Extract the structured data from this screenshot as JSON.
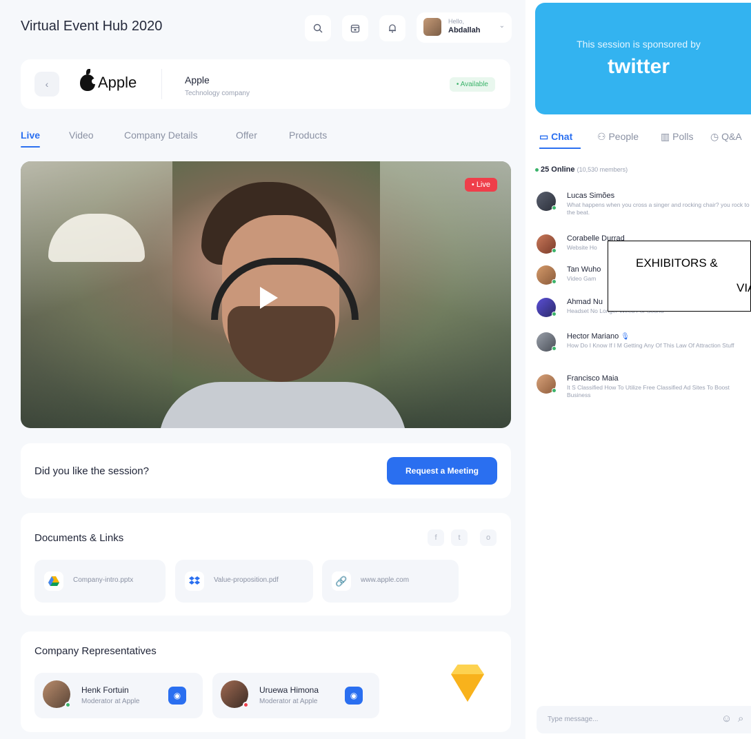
{
  "header": {
    "title": "Virtual Event Hub 2020",
    "greeting": "Hello,",
    "user_name": "Abdallah"
  },
  "company": {
    "logo_text": "Apple",
    "name": "Apple",
    "subtitle": "Technology company",
    "status": "• Available"
  },
  "tabs": [
    "Live",
    "Video",
    "Company Details",
    "Offer",
    "Products"
  ],
  "video": {
    "badge": "• Live"
  },
  "rating": {
    "question": "Did you like the session?",
    "button": "Request a Meeting"
  },
  "documents": {
    "title": "Documents & Links",
    "social": [
      "f",
      "t",
      "o"
    ],
    "items": [
      {
        "icon": "google-drive-icon",
        "label": "Company-intro.pptx"
      },
      {
        "icon": "dropbox-icon",
        "label": "Value-proposition.pdf"
      },
      {
        "icon": "link-icon",
        "label": "www.apple.com"
      }
    ]
  },
  "representatives": {
    "title": "Company Representatives",
    "items": [
      {
        "name": "Henk Fortuin",
        "role": "Moderator at Apple",
        "status_color": "#3bb36a"
      },
      {
        "name": "Uruewa Himona",
        "role": "Moderator at Apple",
        "status_color": "#ef3e4a"
      }
    ]
  },
  "sponsor": {
    "label": "This session is sponsored by",
    "brand": "twitter"
  },
  "side_tabs": [
    "Chat",
    "People",
    "Polls",
    "Q&A"
  ],
  "online": {
    "count": "25 Online",
    "members": "(10,530 members)"
  },
  "messages": [
    {
      "name": "Lucas Simões",
      "text": "What happens when you cross a singer and rocking chair? you rock to the beat."
    },
    {
      "name": "Corabelle Durrad",
      "text": "Website Ho"
    },
    {
      "name": "Tan Wuho",
      "text": "Video Gam"
    },
    {
      "name": "Ahmad Nu",
      "text": "Headset No Longer Wired For Sound"
    },
    {
      "name": "Hector Mariano",
      "text": "How Do I Know If I M Getting Any Of This Law Of Attraction Stuff"
    },
    {
      "name": "Francisco Maia",
      "text": "It S Classified How To Utilize Free Classified Ad Sites To Boost Business"
    }
  ],
  "message_input": {
    "placeholder": "Type message..."
  },
  "overlay": {
    "line1": "EXHIBITORS &",
    "line2": "VIA"
  },
  "colors": {
    "accent": "#2a6ff0",
    "live": "#ef3e4a",
    "available": "#3bb36a",
    "sponsor": "#33b3f0"
  }
}
